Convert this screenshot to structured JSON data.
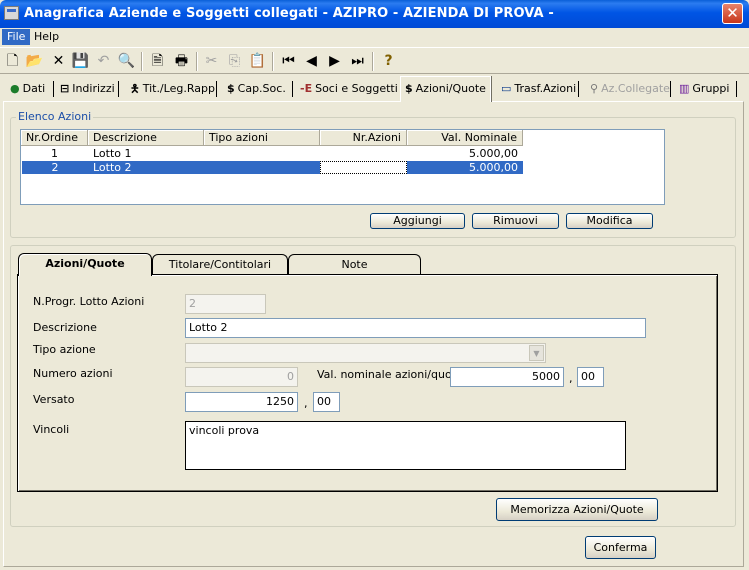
{
  "window": {
    "title": "Anagrafica Aziende e Soggetti collegati - AZIPRO - AZIENDA DI PROVA  -",
    "close_glyph": "✕"
  },
  "menu": [
    {
      "label": "File"
    },
    {
      "label": "Help"
    }
  ],
  "toolbar": {
    "new": "🗋",
    "open": "📂",
    "delete": "✕",
    "save": "💾",
    "undo": "↶",
    "find": "🔍",
    "preview": "🗎",
    "print": "🖶",
    "cut": "✂",
    "copy": "⎘",
    "paste": "📋",
    "first": "⏮",
    "prev": "◀",
    "next": "▶",
    "last": "⏭",
    "help": "?"
  },
  "tabs": {
    "dati": "Dati",
    "indirizzi": "Indirizzi",
    "tit": "Tit./Leg.Rapp",
    "cap": "Cap.Soc.",
    "soci": "Soci e Soggetti",
    "azioni": "Azioni/Quote",
    "trasf": "Trasf.Azioni",
    "azcoll": "Az.Collegate",
    "gruppi": "Gruppi"
  },
  "elenco": {
    "legend": "Elenco Azioni",
    "columns": [
      "Nr.Ordine",
      "Descrizione",
      "Tipo azioni",
      "Nr.Azioni",
      "Val. Nominale"
    ],
    "rows": [
      {
        "nr": "1",
        "descr": "Lotto 1",
        "tipo": "",
        "nazioni": "",
        "val": "5.000,00"
      },
      {
        "nr": "2",
        "descr": "Lotto 2",
        "tipo": "",
        "nazioni": "",
        "val": "5.000,00"
      }
    ],
    "buttons": {
      "add": "Aggiungi",
      "remove": "Rimuovi",
      "edit": "Modifica"
    }
  },
  "detail_tabs": {
    "azioni": "Azioni/Quote",
    "titolare": "Titolare/Contitolari",
    "note": "Note"
  },
  "form": {
    "progr_label": "N.Progr. Lotto Azioni",
    "progr_value": "2",
    "descr_label": "Descrizione",
    "descr_value": "Lotto 2",
    "tipo_label": "Tipo azione",
    "tipo_value": "",
    "numero_label": "Numero azioni",
    "numero_value": "0",
    "valnom_label": "Val. nominale azioni/quote",
    "valnom_int": "5000",
    "valnom_dec": "00",
    "versato_label": "Versato",
    "versato_int": "1250",
    "versato_dec": "00",
    "vincoli_label": "Vincoli",
    "vincoli_value": "vincoli prova",
    "decimal_sep": ","
  },
  "buttons": {
    "memorizza": "Memorizza Azioni/Quote",
    "conferma": "Conferma"
  }
}
